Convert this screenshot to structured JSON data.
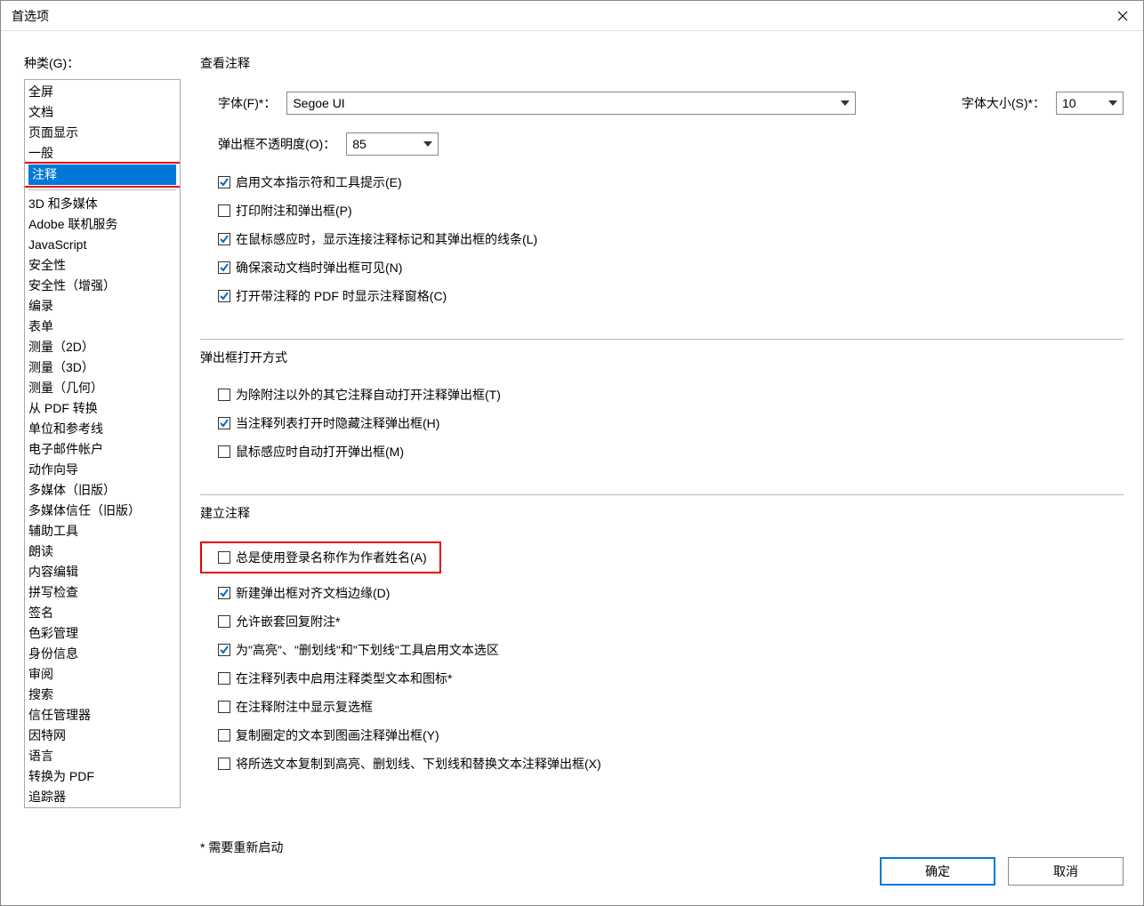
{
  "window": {
    "title": "首选项"
  },
  "sidebar": {
    "label": "种类(G)：",
    "items": [
      "全屏",
      "文档",
      "页面显示",
      "一般",
      "注释",
      "",
      "3D 和多媒体",
      "Adobe 联机服务",
      "JavaScript",
      "安全性",
      "安全性（增强）",
      "编录",
      "表单",
      "测量（2D）",
      "测量（3D）",
      "测量（几何）",
      "从 PDF 转换",
      "单位和参考线",
      "电子邮件帐户",
      "动作向导",
      "多媒体（旧版）",
      "多媒体信任（旧版）",
      "辅助工具",
      "朗读",
      "内容编辑",
      "拼写检查",
      "签名",
      "色彩管理",
      "身份信息",
      "审阅",
      "搜索",
      "信任管理器",
      "因特网",
      "语言",
      "转换为 PDF",
      "追踪器"
    ],
    "selectedIndex": 4
  },
  "sections": {
    "view": {
      "title": "查看注释",
      "font_label": "字体(F)*：",
      "font_value": "Segoe UI",
      "size_label": "字体大小(S)*：",
      "size_value": "10",
      "opacity_label": "弹出框不透明度(O)：",
      "opacity_value": "85",
      "checks": [
        {
          "label": "启用文本指示符和工具提示(E)",
          "checked": true
        },
        {
          "label": "打印附注和弹出框(P)",
          "checked": false
        },
        {
          "label": "在鼠标感应时，显示连接注释标记和其弹出框的线条(L)",
          "checked": true
        },
        {
          "label": "确保滚动文档时弹出框可见(N)",
          "checked": true
        },
        {
          "label": "打开带注释的 PDF 时显示注释窗格(C)",
          "checked": true
        }
      ]
    },
    "popup": {
      "title": "弹出框打开方式",
      "checks": [
        {
          "label": "为除附注以外的其它注释自动打开注释弹出框(T)",
          "checked": false
        },
        {
          "label": "当注释列表打开时隐藏注释弹出框(H)",
          "checked": true
        },
        {
          "label": "鼠标感应时自动打开弹出框(M)",
          "checked": false
        }
      ]
    },
    "create": {
      "title": "建立注释",
      "highlighted": {
        "label": "总是使用登录名称作为作者姓名(A)",
        "checked": false
      },
      "checks": [
        {
          "label": "新建弹出框对齐文档边缘(D)",
          "checked": true
        },
        {
          "label": "允许嵌套回复附注*",
          "checked": false
        },
        {
          "label": "为\"高亮\"、\"删划线\"和\"下划线\"工具启用文本选区",
          "checked": true
        },
        {
          "label": "在注释列表中启用注释类型文本和图标*",
          "checked": false
        },
        {
          "label": "在注释附注中显示复选框",
          "checked": false
        },
        {
          "label": "复制圈定的文本到图画注释弹出框(Y)",
          "checked": false
        },
        {
          "label": "将所选文本复制到高亮、删划线、下划线和替换文本注释弹出框(X)",
          "checked": false
        }
      ]
    }
  },
  "footnote": "* 需要重新启动",
  "buttons": {
    "ok": "确定",
    "cancel": "取消"
  }
}
